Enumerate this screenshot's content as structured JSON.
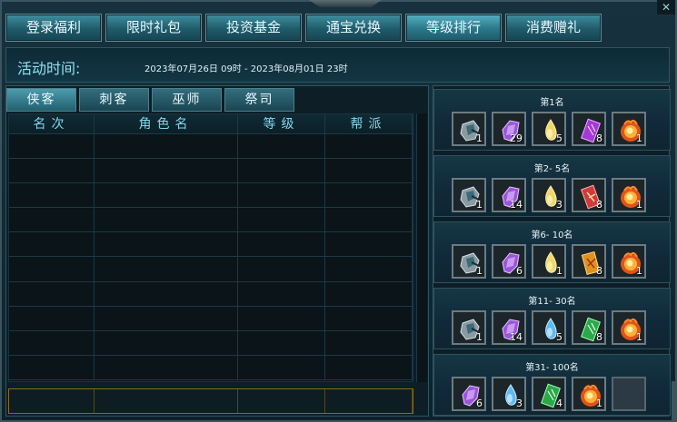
{
  "tabs": [
    {
      "label": "登录福利"
    },
    {
      "label": "限时礼包"
    },
    {
      "label": "投资基金"
    },
    {
      "label": "通宝兑换"
    },
    {
      "label": "等级排行"
    },
    {
      "label": "消费赠礼"
    }
  ],
  "active_tab": "等级排行",
  "activity": {
    "label": "活动时间:",
    "time": "2023年07月26日 09时   -   2023年08月01日 23时"
  },
  "class_tabs": [
    {
      "label": "侠客"
    },
    {
      "label": "刺客"
    },
    {
      "label": "巫师"
    },
    {
      "label": "祭司"
    }
  ],
  "table": {
    "headers": [
      "名次",
      "角色名",
      "等级",
      "帮派"
    ]
  },
  "reward_tiers": [
    {
      "title": "第1名",
      "items": [
        {
          "icon": "gauntlet-icon",
          "qty": "1"
        },
        {
          "icon": "purple-crystal-icon",
          "qty": "29"
        },
        {
          "icon": "yellow-gem-icon",
          "qty": "5"
        },
        {
          "icon": "purple-scroll-icon",
          "qty": "8"
        },
        {
          "icon": "fire-orb-icon",
          "qty": "1"
        }
      ]
    },
    {
      "title": "第2- 5名",
      "items": [
        {
          "icon": "gauntlet-icon",
          "qty": "1"
        },
        {
          "icon": "purple-crystal-icon",
          "qty": "14"
        },
        {
          "icon": "yellow-gem-icon",
          "qty": "3"
        },
        {
          "icon": "red-scroll-icon",
          "qty": "8"
        },
        {
          "icon": "fire-orb-icon",
          "qty": "1"
        }
      ]
    },
    {
      "title": "第6- 10名",
      "items": [
        {
          "icon": "gauntlet-icon",
          "qty": "1"
        },
        {
          "icon": "purple-crystal-icon",
          "qty": "6"
        },
        {
          "icon": "yellow-gem-icon",
          "qty": "1"
        },
        {
          "icon": "orange-scroll-icon",
          "qty": "8"
        },
        {
          "icon": "fire-orb-icon",
          "qty": "1"
        }
      ]
    },
    {
      "title": "第11- 30名",
      "items": [
        {
          "icon": "gauntlet-icon",
          "qty": "1"
        },
        {
          "icon": "purple-crystal-icon",
          "qty": "14"
        },
        {
          "icon": "blue-gem-icon",
          "qty": "5"
        },
        {
          "icon": "green-scroll-icon",
          "qty": "8"
        },
        {
          "icon": "fire-orb-icon",
          "qty": "1"
        }
      ]
    },
    {
      "title": "第31- 100名",
      "items": [
        {
          "icon": "purple-crystal-icon",
          "qty": "6"
        },
        {
          "icon": "blue-gem-icon",
          "qty": "3"
        },
        {
          "icon": "green-scroll-icon",
          "qty": "4"
        },
        {
          "icon": "fire-orb-icon",
          "qty": "1"
        },
        {
          "icon": "empty-slot",
          "qty": ""
        }
      ]
    }
  ],
  "colors": {
    "accent": "#7fd8ee",
    "tab_bg": "#1f5b6a",
    "panel_bg": "#0d1e26"
  }
}
